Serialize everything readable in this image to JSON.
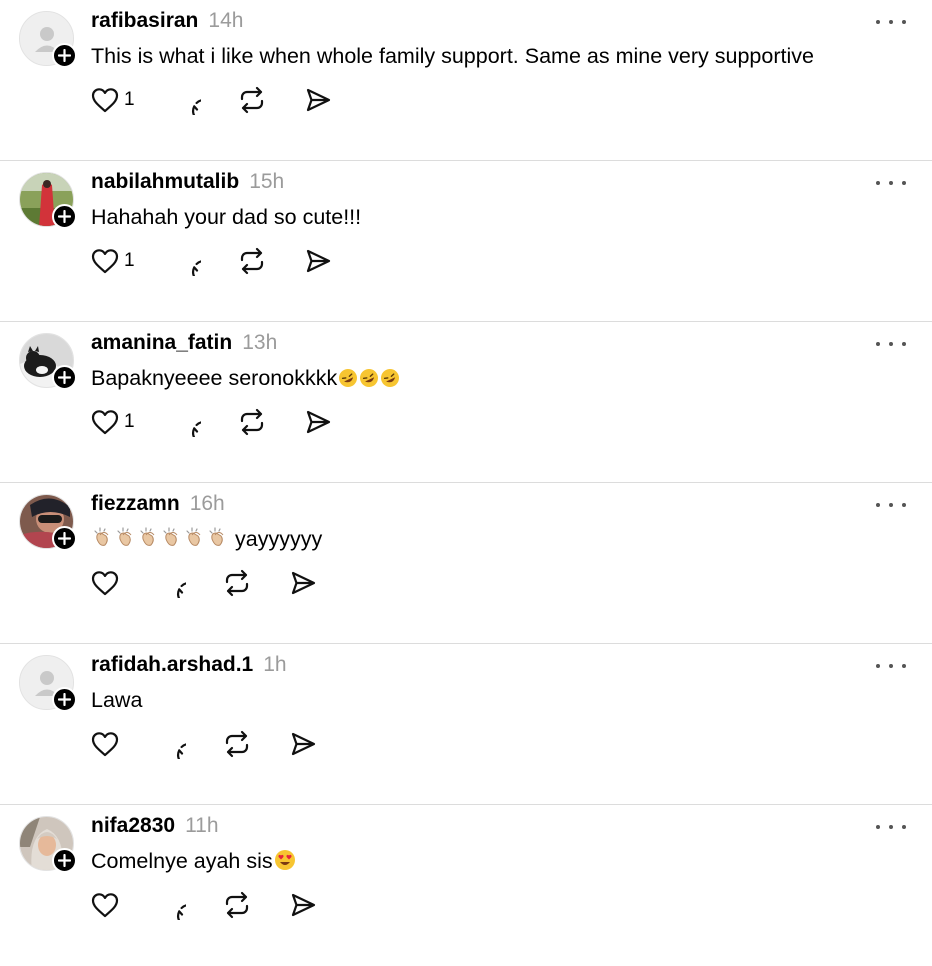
{
  "colors": {
    "text": "#000000",
    "muted": "#9b9b9b",
    "divider": "#dcdcdc"
  },
  "posts": [
    {
      "username": "rafibasiran",
      "time": "14h",
      "text": "This is what i like when whole family support. Same as mine very supportive",
      "likes": "1",
      "avatar": "default-avatar"
    },
    {
      "username": "nabilahmutalib",
      "time": "15h",
      "text": "Hahahah your dad so cute!!!",
      "likes": "1",
      "avatar": "photo-red-dress"
    },
    {
      "username": "amanina_fatin",
      "time": "13h",
      "text": "Bapaknyeeee seronokkkk",
      "emoji": "rolling-on-floor-laughing x3",
      "likes": "1",
      "avatar": "photo-cat"
    },
    {
      "username": "fiezzamn",
      "time": "16h",
      "text": "yayyyyyy",
      "emoji": "clapping-hands x6",
      "likes": "",
      "avatar": "photo-selfie"
    },
    {
      "username": "rafidah.arshad.1",
      "time": "1h",
      "text": "Lawa",
      "likes": "",
      "avatar": "default-avatar"
    },
    {
      "username": "nifa2830",
      "time": "11h",
      "text": "Comelnye ayah sis",
      "emoji": "smiling-face-with-heart-eyes",
      "likes": "",
      "avatar": "photo-hijab"
    }
  ]
}
